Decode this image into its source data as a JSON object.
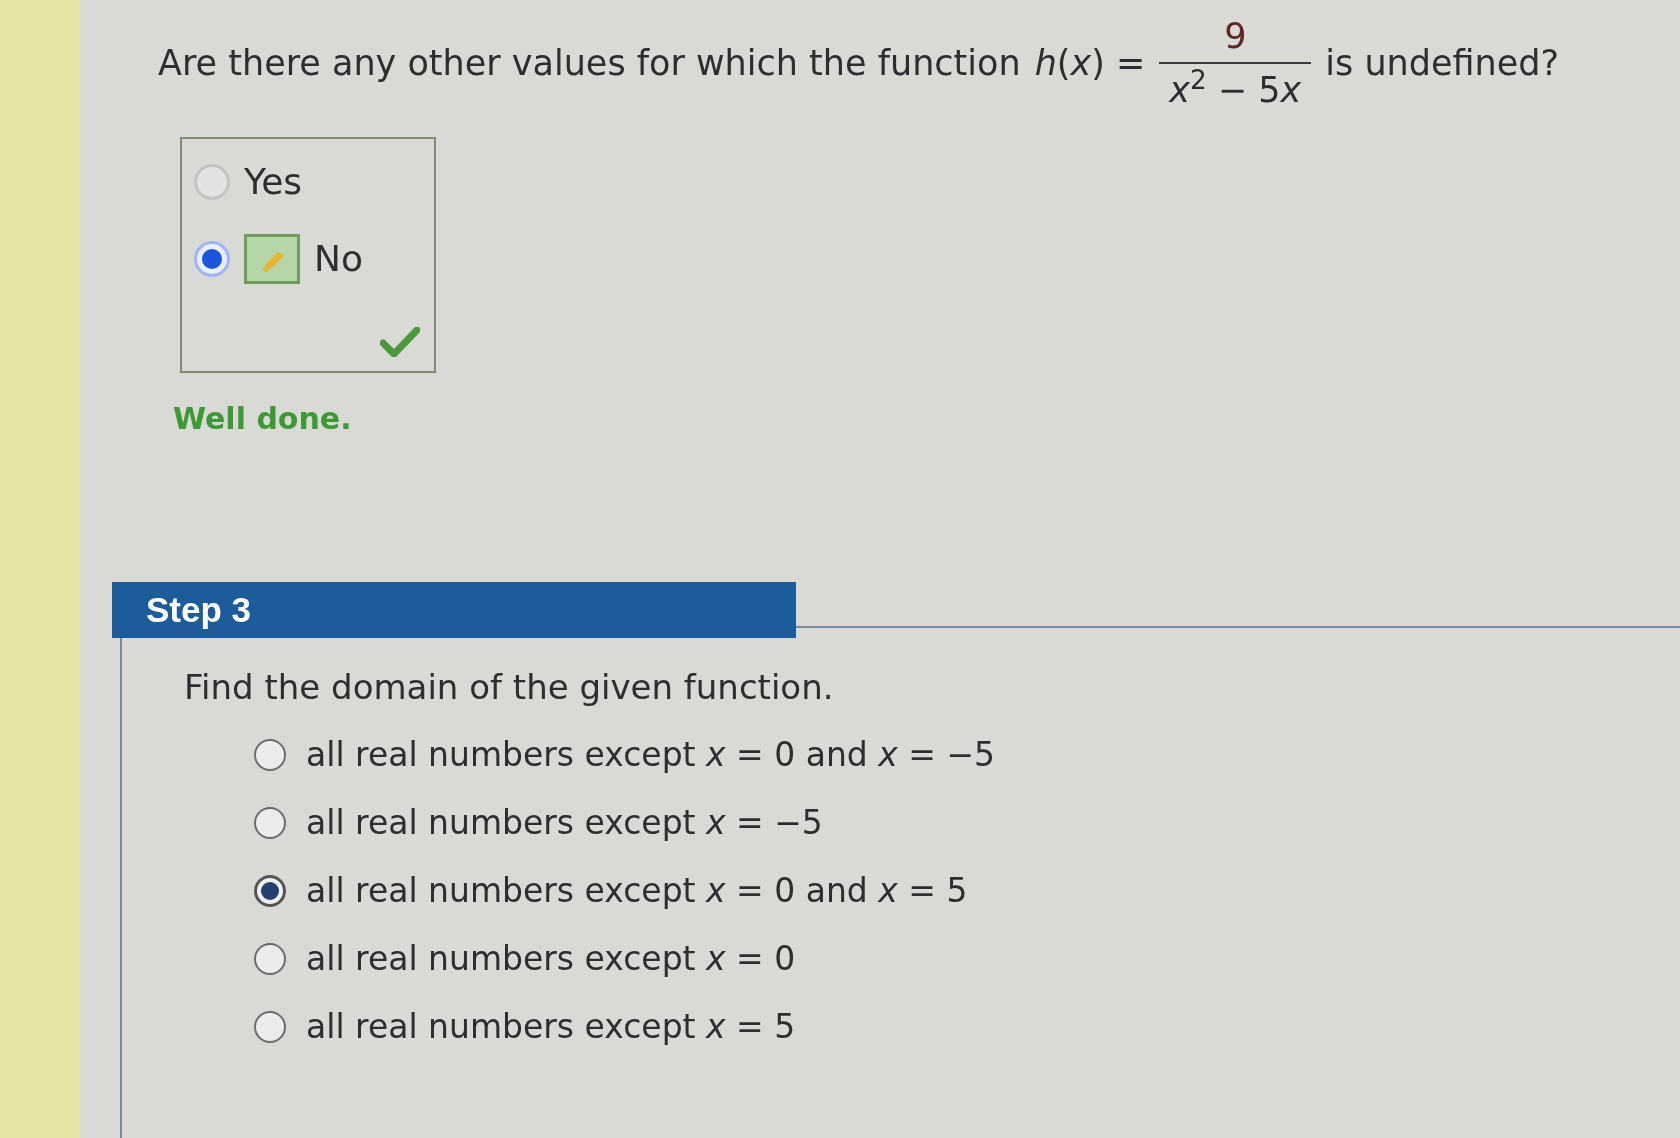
{
  "question": {
    "text_before": "Are there any other values for which the function",
    "lhs": "*h*(*x*) =",
    "numerator": "9",
    "denominator": {
      "first_term": "*x*$^{2}$",
      "operator": "−",
      "coefficient": "5",
      "variable": "x"
    },
    "text_after": "is undefined?"
  },
  "answer_box": {
    "correct": true,
    "choices": [
      {
        "label": "Yes",
        "selected": false,
        "answer_marker": false
      },
      {
        "label": "No",
        "selected": true,
        "answer_marker": true
      }
    ]
  },
  "feedback": "Well done.",
  "step": {
    "title": "Step 3",
    "prompt": "Find the domain of the given function.",
    "choices": [
      {
        "label": "all real numbers except *x* = 0 and *x* = −5",
        "selected": false
      },
      {
        "label": "all real numbers except *x* = −5",
        "selected": false
      },
      {
        "label": "all real numbers except *x* = 0 and *x* = 5",
        "selected": true
      },
      {
        "label": "all real numbers except *x* = 0",
        "selected": false
      },
      {
        "label": "all real numbers except *x* = 5",
        "selected": false
      }
    ]
  }
}
